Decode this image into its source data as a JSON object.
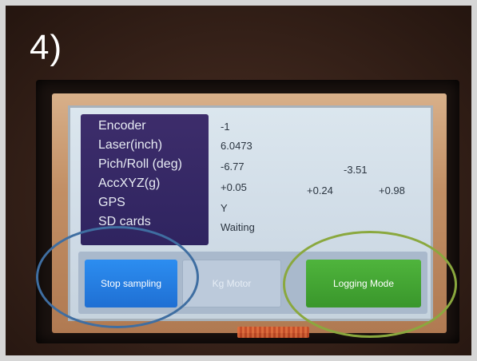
{
  "step": {
    "label": "4)"
  },
  "labels": {
    "encoder": "Encoder",
    "laser": "Laser(inch)",
    "pitch_roll": "Pich/Roll (deg)",
    "acc": "AccXYZ(g)",
    "gps": "GPS",
    "sd": "SD cards"
  },
  "values": {
    "encoder": "-1",
    "laser": "6.0473",
    "pitch": "-6.77",
    "roll": "-3.51",
    "acc_x": "+0.05",
    "acc_y": "+0.24",
    "acc_z": "+0.98",
    "gps": "Y",
    "sd": "Waiting"
  },
  "buttons": {
    "stop": "Stop sampling",
    "motor": "Kg Motor",
    "logging": "Logging Mode"
  },
  "colors": {
    "stop_button": "#1f6fd3",
    "logging_button": "#39962b",
    "label_panel": "#2f2460",
    "highlight_blue": "#3f6ea1",
    "highlight_green": "#8aa83e"
  }
}
